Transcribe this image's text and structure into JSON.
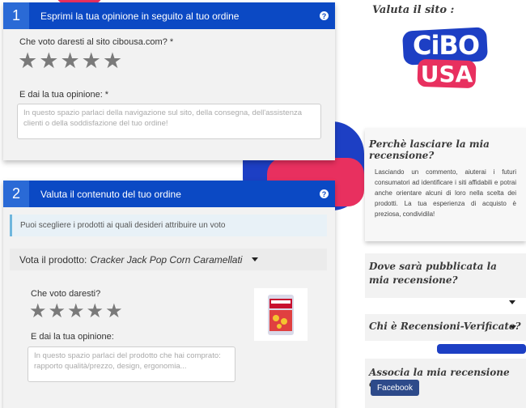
{
  "step1": {
    "number": "1",
    "title": "Esprimi la tua opinione in seguito al tuo ordine",
    "help": "?",
    "rating_label": "Che voto daresti al sito cibousa.com? *",
    "stars": [
      "★",
      "★",
      "★",
      "★",
      "★"
    ],
    "opinion_label": "E dai la tua opinione: *",
    "opinion_placeholder": "In questo spazio parlaci della navigazione sul sito, della consegna, dell'assistenza clienti o della soddisfazione del tuo ordine!"
  },
  "step2": {
    "number": "2",
    "title": "Valuta il contenuto del tuo ordine",
    "help": "?",
    "info": "Puoi scegliere i prodotti ai quali desideri attribuire un voto",
    "product_label": "Vota il prodotto:",
    "product_name": "Cracker Jack Pop Corn Caramellati",
    "rating_label": "Che voto daresti?",
    "stars": [
      "★",
      "★",
      "★",
      "★",
      "★"
    ],
    "opinion_label": "E dai la tua opinione:",
    "opinion_placeholder": "In questo spazio parlaci del prodotto che hai comprato: rapporto qualità/prezzo, design, ergonomia..."
  },
  "sidebar": {
    "rate_site_title": "Valuta il sito :",
    "logo_top": "CiBO",
    "logo_bottom": "USA",
    "why_title": "Perchè lasciare la mia recensione?",
    "why_text": "Lasciando un commento, aiuterai i futuri consumatori ad identificare i siti affidabili e potrai anche orientare alcuni di loro nella scelta dei prodotti. La tua esperienza di acquisto è preziosa, condividila!",
    "where_title": "Dove sarà pubblicata la mia recensione?",
    "who_title": "Chi è Recensioni-Verificate?",
    "associate_title": "Associa la mia recensione con",
    "facebook_label": "Facebook"
  },
  "colors": {
    "header_blue": "#0b49c4",
    "step_blue": "#2a6ad6",
    "logo_blue": "#1d3fc4",
    "logo_pink": "#e8305f"
  }
}
